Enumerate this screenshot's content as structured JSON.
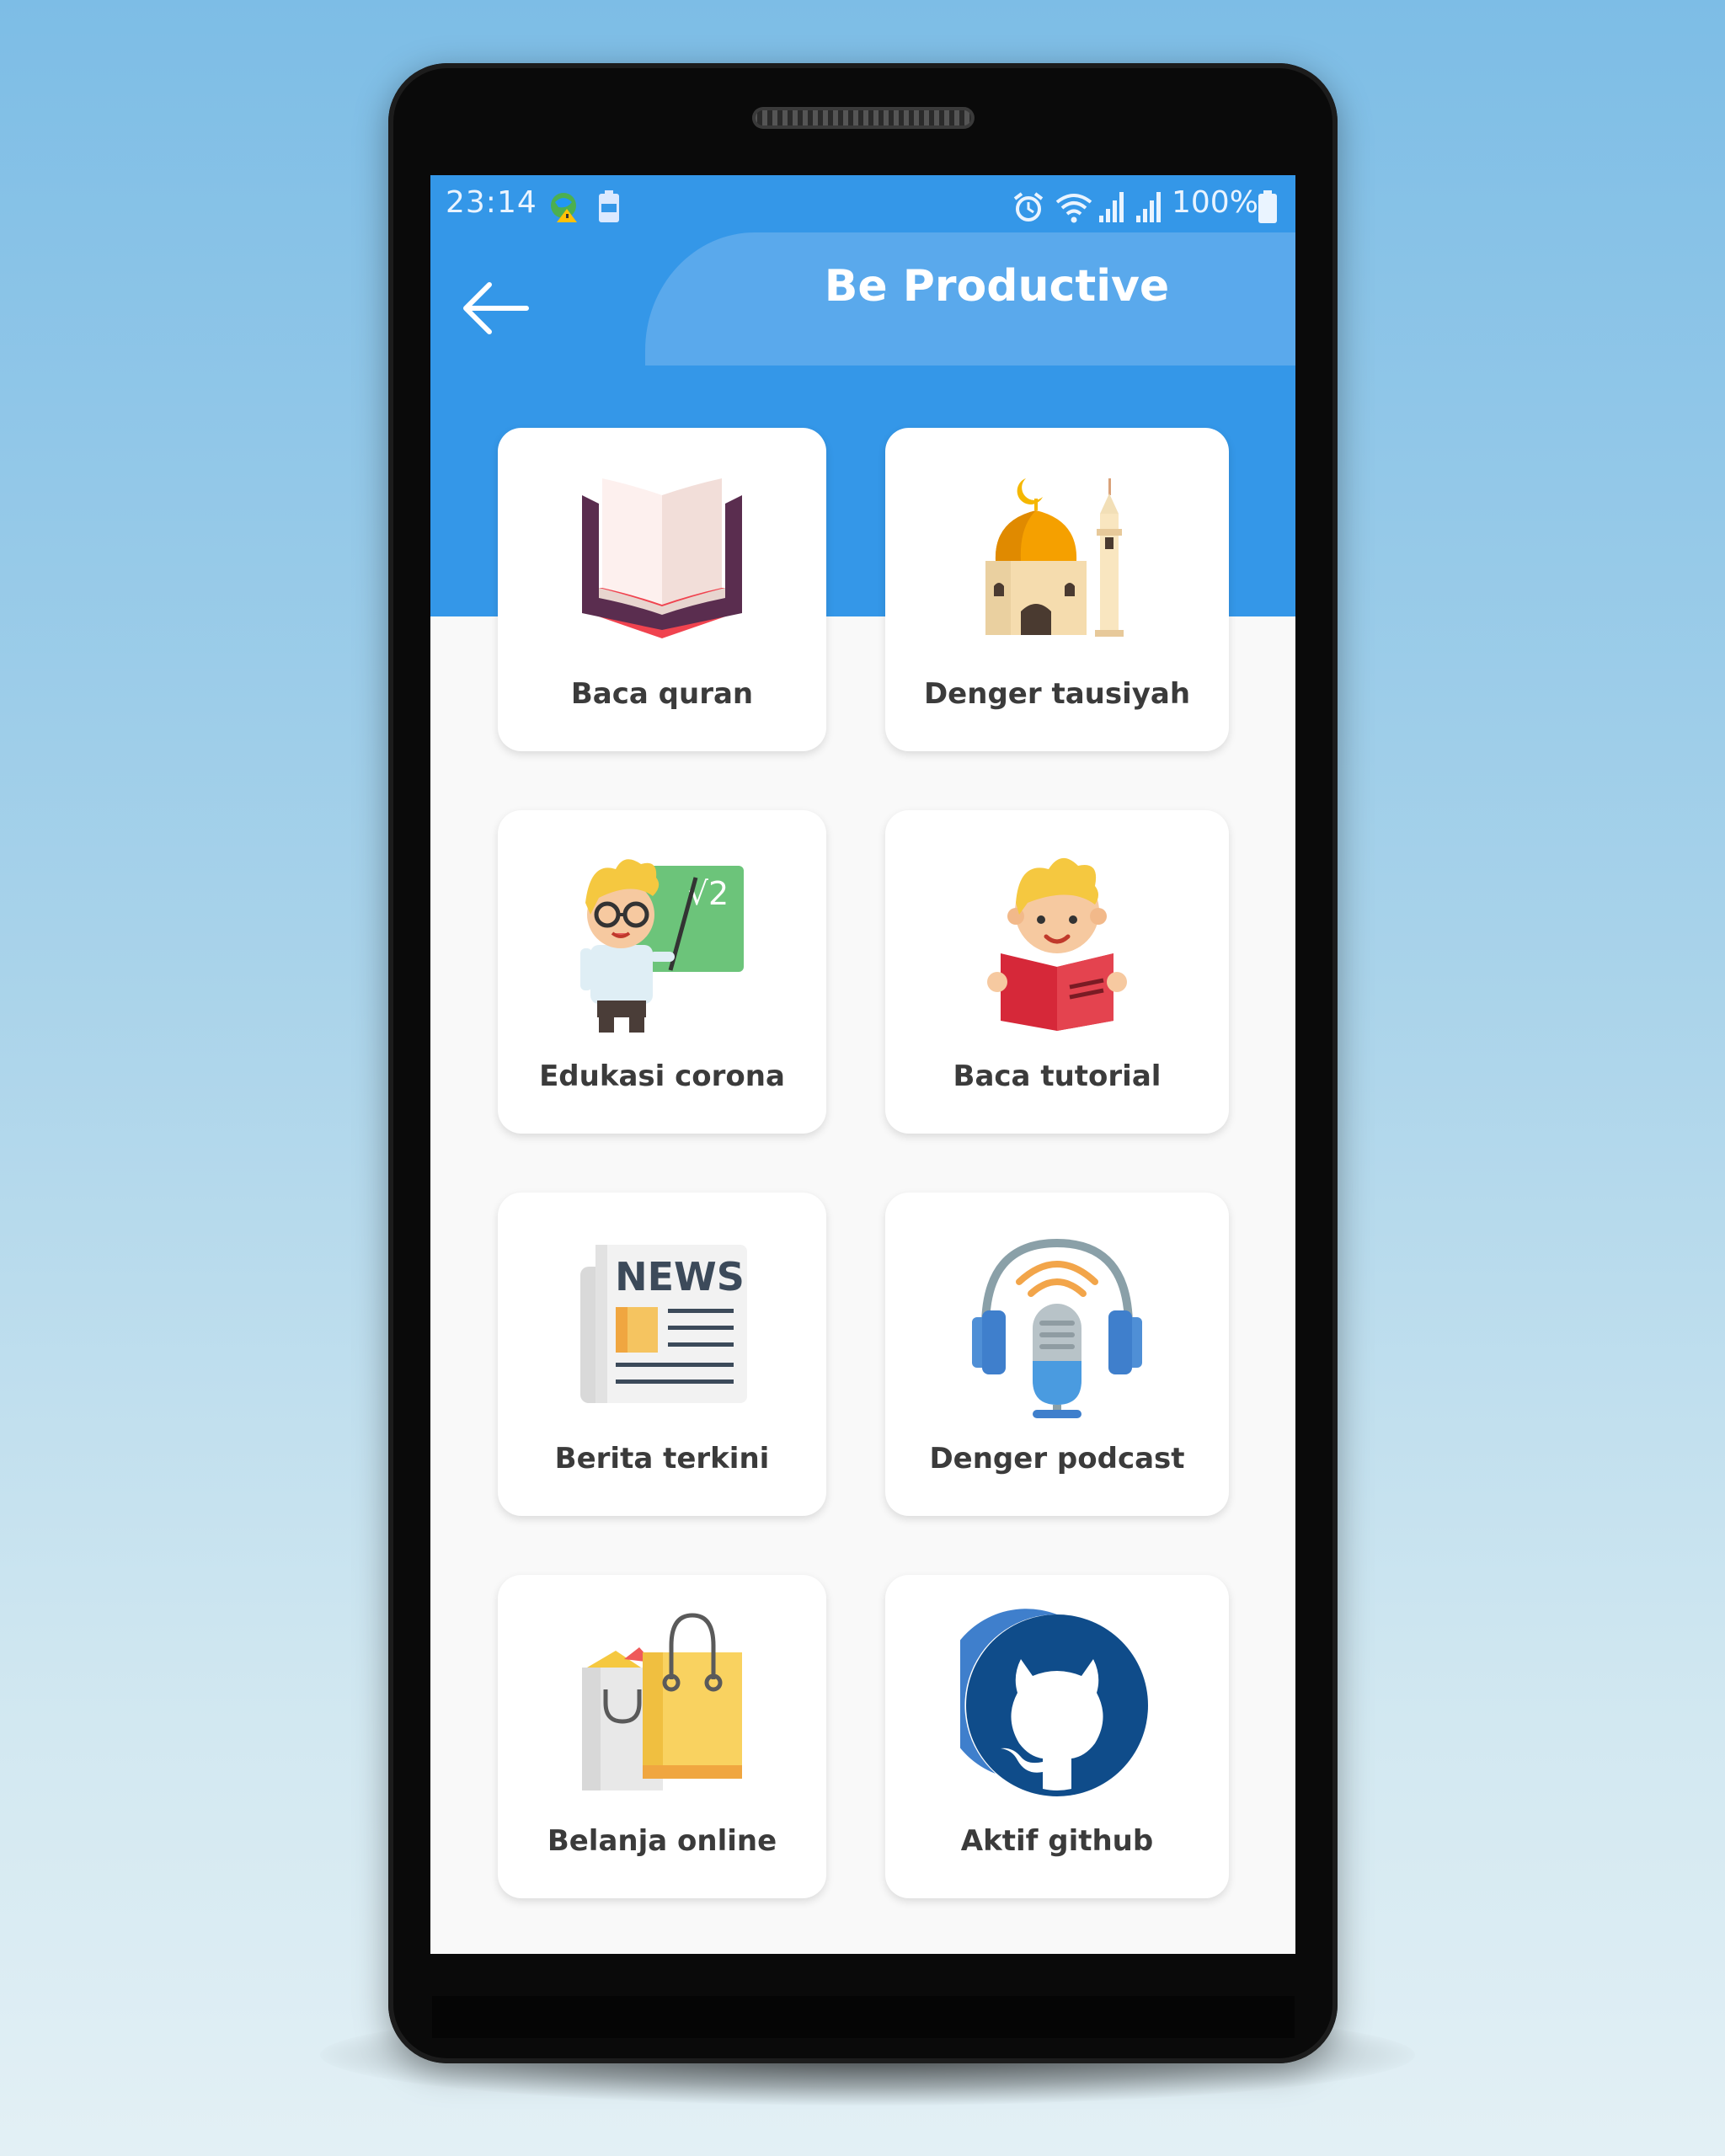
{
  "status_bar": {
    "time": "23:14",
    "battery_percent": "100%"
  },
  "header": {
    "title": "Be Productive"
  },
  "menu": [
    {
      "label": "Baca quran",
      "icon": "quran-icon"
    },
    {
      "label": "Denger tausiyah",
      "icon": "mosque-icon"
    },
    {
      "label": "Edukasi corona",
      "icon": "teacher-icon"
    },
    {
      "label": "Baca tutorial",
      "icon": "reading-boy-icon"
    },
    {
      "label": "Berita terkini",
      "icon": "newspaper-icon"
    },
    {
      "label": "Denger podcast",
      "icon": "podcast-mic-icon"
    },
    {
      "label": "Belanja online",
      "icon": "shopping-bags-icon"
    },
    {
      "label": "Aktif github",
      "icon": "github-icon"
    }
  ],
  "icon_text": {
    "news": "NEWS",
    "sqrt": "√2"
  },
  "colors": {
    "primary": "#3497e8",
    "header_tab": "#5aa9ec",
    "card": "#ffffff",
    "label": "#3b3b3b"
  }
}
